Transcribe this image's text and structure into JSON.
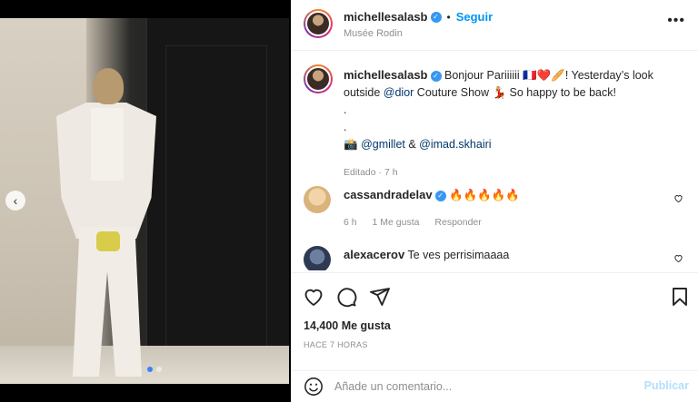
{
  "post": {
    "username": "michellesalasb",
    "follow_label": "Seguir",
    "separator": "•",
    "location": "Musée Rodin",
    "more_label": "•••"
  },
  "media": {
    "carousel_dots": 2,
    "active_dot": 1,
    "prev_label": "‹"
  },
  "caption": {
    "username": "michellesalasb",
    "text_1": "Bonjour Pariiiiii 🇫🇷❤️🥖! Yesterday’s look outside ",
    "mention_dior": "@dior",
    "text_2": " Couture Show 💃🏼 So happy to be back!",
    "dots_1": ".",
    "dots_2": ".",
    "camera": "📸",
    "mention_gmillet": "@gmillet",
    "amp": " & ",
    "mention_imad": "@imad.skhairi",
    "meta": "Editado · 7 h"
  },
  "comments": [
    {
      "username": "cassandradelav",
      "text": "🔥🔥🔥🔥🔥",
      "time": "6 h",
      "likes": "1 Me gusta",
      "reply": "Responder",
      "avatar_color": "#e8c99a"
    },
    {
      "username": "alexacerov",
      "text": "Te ves perrisimaaaa",
      "avatar_color": "#3b4a63"
    }
  ],
  "actions": {
    "likes": "14,400 Me gusta",
    "time_ago": "HACE 7 HORAS"
  },
  "add_comment": {
    "placeholder": "Añade un comentario...",
    "publish_label": "Publicar"
  },
  "colors": {
    "accent": "#0095f6",
    "verified": "#3897f0",
    "muted": "#8e8e8e"
  }
}
